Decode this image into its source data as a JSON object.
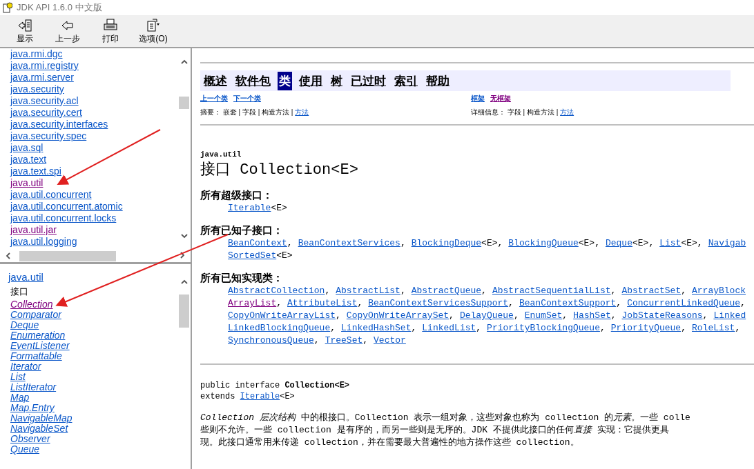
{
  "window": {
    "title": "JDK API 1.6.0 中文版"
  },
  "toolbar": [
    {
      "label": "显示"
    },
    {
      "label": "上一步"
    },
    {
      "label": "打印"
    },
    {
      "label": "选项(O)"
    }
  ],
  "packages": [
    {
      "name": "java.rmi.dgc",
      "visited": false
    },
    {
      "name": "java.rmi.registry",
      "visited": false
    },
    {
      "name": "java.rmi.server",
      "visited": false
    },
    {
      "name": "java.security",
      "visited": false
    },
    {
      "name": "java.security.acl",
      "visited": false
    },
    {
      "name": "java.security.cert",
      "visited": false
    },
    {
      "name": "java.security.interfaces",
      "visited": false
    },
    {
      "name": "java.security.spec",
      "visited": false
    },
    {
      "name": "java.sql",
      "visited": false
    },
    {
      "name": "java.text",
      "visited": false
    },
    {
      "name": "java.text.spi",
      "visited": false
    },
    {
      "name": "java.util",
      "visited": true
    },
    {
      "name": "java.util.concurrent",
      "visited": false
    },
    {
      "name": "java.util.concurrent.atomic",
      "visited": false
    },
    {
      "name": "java.util.concurrent.locks",
      "visited": false
    },
    {
      "name": "java.util.jar",
      "visited": true
    },
    {
      "name": "java.util.logging",
      "visited": false
    }
  ],
  "package_frame": {
    "title": "java.util",
    "section": "接口",
    "classes": [
      {
        "name": "Collection",
        "visited": true
      },
      {
        "name": "Comparator",
        "visited": false
      },
      {
        "name": "Deque",
        "visited": false
      },
      {
        "name": "Enumeration",
        "visited": false
      },
      {
        "name": "EventListener",
        "visited": false
      },
      {
        "name": "Formattable",
        "visited": false
      },
      {
        "name": "Iterator",
        "visited": false
      },
      {
        "name": "List",
        "visited": false
      },
      {
        "name": "ListIterator",
        "visited": false
      },
      {
        "name": "Map",
        "visited": false
      },
      {
        "name": "Map.Entry",
        "visited": false
      },
      {
        "name": "NavigableMap",
        "visited": false
      },
      {
        "name": "NavigableSet",
        "visited": false
      },
      {
        "name": "Observer",
        "visited": false
      },
      {
        "name": "Queue",
        "visited": false
      }
    ]
  },
  "navbar": [
    {
      "label": "概述",
      "selected": false
    },
    {
      "label": "软件包",
      "selected": false
    },
    {
      "label": "类",
      "selected": true
    },
    {
      "label": "使用",
      "selected": false
    },
    {
      "label": "树",
      "selected": false
    },
    {
      "label": "已过时",
      "selected": false
    },
    {
      "label": "索引",
      "selected": false
    },
    {
      "label": "帮助",
      "selected": false
    }
  ],
  "subnav_left": [
    {
      "text": "上一个类",
      "visited": false
    },
    {
      "text": "下一个类",
      "visited": false
    }
  ],
  "subnav_right": [
    {
      "text": "框架",
      "visited": false
    },
    {
      "text": "无框架",
      "visited": true
    }
  ],
  "summary_left": [
    {
      "text": "摘要： 嵌套 | 字段 | 构造方法 | ",
      "link": false
    },
    {
      "text": "方法",
      "link": true
    }
  ],
  "summary_right": [
    {
      "text": "详细信息： 字段 | 构造方法 | ",
      "link": false
    },
    {
      "text": "方法",
      "link": true
    }
  ],
  "package_name": "java.util",
  "class_title": "接口 Collection<E>",
  "sections": [
    {
      "heading": "所有超级接口：",
      "lines": [
        [
          {
            "link": "Iterable",
            "suffix": "<E>",
            "visited": false
          }
        ]
      ]
    },
    {
      "heading": "所有已知子接口：",
      "lines": [
        [
          {
            "link": "BeanContext",
            "suffix": ",",
            "visited": false
          },
          {
            "link": "BeanContextServices",
            "suffix": ",",
            "visited": false
          },
          {
            "link": "BlockingDeque",
            "suffix": "<E>,",
            "visited": false
          },
          {
            "link": "BlockingQueue",
            "suffix": "<E>,",
            "visited": false
          },
          {
            "link": "Deque",
            "suffix": "<E>,",
            "visited": false
          },
          {
            "link": "List",
            "suffix": "<E>,",
            "visited": false
          },
          {
            "link": "Navigab",
            "visited": false
          }
        ],
        [
          {
            "link": "SortedSet",
            "suffix": "<E>",
            "visited": false
          }
        ]
      ]
    },
    {
      "heading": "所有已知实现类：",
      "lines": [
        [
          {
            "link": "AbstractCollection",
            "suffix": ",",
            "visited": false
          },
          {
            "link": "AbstractList",
            "suffix": ",",
            "visited": false
          },
          {
            "link": "AbstractQueue",
            "suffix": ",",
            "visited": false
          },
          {
            "link": "AbstractSequentialList",
            "suffix": ",",
            "visited": false
          },
          {
            "link": "AbstractSet",
            "suffix": ",",
            "visited": false
          },
          {
            "link": "ArrayBlock",
            "visited": false
          }
        ],
        [
          {
            "link": "ArrayList",
            "suffix": ",",
            "visited": true
          },
          {
            "link": "AttributeList",
            "suffix": ",",
            "visited": false
          },
          {
            "link": "BeanContextServicesSupport",
            "suffix": ",",
            "visited": false
          },
          {
            "link": "BeanContextSupport",
            "suffix": ",",
            "visited": false
          },
          {
            "link": "ConcurrentLinkedQueue",
            "suffix": ",",
            "visited": false
          }
        ],
        [
          {
            "link": "CopyOnWriteArrayList",
            "suffix": ",",
            "visited": false
          },
          {
            "link": "CopyOnWriteArraySet",
            "suffix": ",",
            "visited": false
          },
          {
            "link": "DelayQueue",
            "suffix": ",",
            "visited": false
          },
          {
            "link": "EnumSet",
            "suffix": ",",
            "visited": false
          },
          {
            "link": "HashSet",
            "suffix": ",",
            "visited": false
          },
          {
            "link": "JobStateReasons",
            "suffix": ",",
            "visited": false
          },
          {
            "link": "Linked",
            "visited": false
          }
        ],
        [
          {
            "link": "LinkedBlockingQueue",
            "suffix": ",",
            "visited": false
          },
          {
            "link": "LinkedHashSet",
            "suffix": ",",
            "visited": false
          },
          {
            "link": "LinkedList",
            "suffix": ",",
            "visited": false
          },
          {
            "link": "PriorityBlockingQueue",
            "suffix": ",",
            "visited": false
          },
          {
            "link": "PriorityQueue",
            "suffix": ",",
            "visited": false
          },
          {
            "link": "RoleList",
            "suffix": ",",
            "visited": false
          }
        ],
        [
          {
            "link": "SynchronousQueue",
            "suffix": ",",
            "visited": false
          },
          {
            "link": "TreeSet",
            "suffix": ",",
            "visited": false
          },
          {
            "link": "Vector",
            "visited": false
          }
        ]
      ]
    }
  ],
  "declaration": {
    "prefix": "public interface ",
    "name": "Collection<E>",
    "extends_label": "extends ",
    "extends_link": "Iterable",
    "extends_suffix": "<E>"
  },
  "description_lines": [
    [
      {
        "text": "Collection 层次结构",
        "italic": true
      },
      {
        "text": " 中的根接口。Collection 表示一组对象，这些对象也称为 collection 的",
        "italic": false
      },
      {
        "text": "元素",
        "italic": true
      },
      {
        "text": "。一些 colle",
        "italic": false
      }
    ],
    [
      {
        "text": "些则不允许。一些 collection 是有序的，而另一些则是无序的。JDK 不提供此接口的任何",
        "italic": false
      },
      {
        "text": "直接",
        "italic": true
      },
      {
        "text": " 实现：它提供更具",
        "italic": false
      }
    ],
    [
      {
        "text": "现。此接口通常用来传递 collection，并在需要最大普遍性的地方操作这些 collection。",
        "italic": false
      }
    ]
  ]
}
